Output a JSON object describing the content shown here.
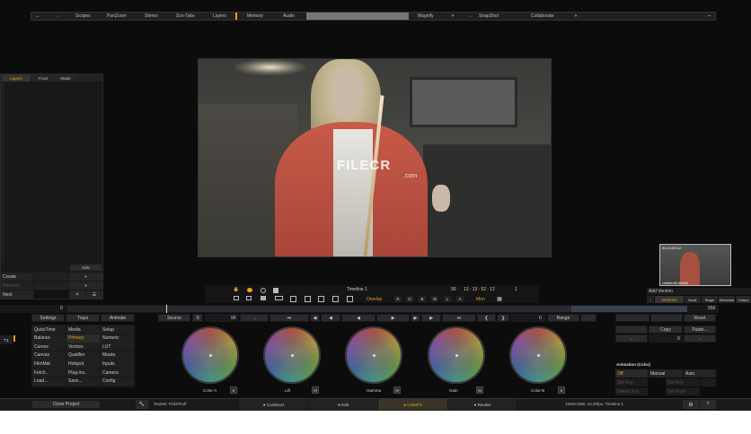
{
  "topbar": {
    "items": [
      "Scopes",
      "PanZoom",
      "Stereo",
      "Scn-Take",
      "Layers",
      "Memory",
      "Audio"
    ],
    "magnify": "Magnify",
    "snapshot": "SnapShot",
    "collaborate": "Collaborate",
    "minimize": "–"
  },
  "left_panel": {
    "tabs": [
      "Layers",
      "Front",
      "Matte"
    ],
    "solo": "Solo",
    "create": "Create",
    "remove": "Remove",
    "next": "Next",
    "plus": "+",
    "close": "×"
  },
  "viewer": {
    "watermark": "FILECR",
    "watermark_sub": ".com"
  },
  "thumbnail": {
    "timecode": "01:13:52:12",
    "name": "Untitled0140000"
  },
  "timeline_bar": {
    "title": "Timeline 1",
    "frame": "90",
    "timecode": "13 : 13 : 52 : 12",
    "count": "1",
    "overlay": "Overlay",
    "channels": [
      "R",
      "G",
      "B",
      "M",
      "L",
      "A"
    ],
    "mon": "Mon"
  },
  "scrub": {
    "start": "0",
    "end": "550"
  },
  "right_side": {
    "add_version": "Add Version",
    "tabs": [
      "Versions",
      "Node",
      "Stage",
      "Metadata",
      "Output"
    ]
  },
  "controls": {
    "settings": "Settings",
    "trays": "Trays",
    "animate": "Animate",
    "source": "Source",
    "s": "S",
    "frame_value": "90",
    "range": "Range",
    "range_value": "0",
    "reset": "Reset",
    "copy": "Copy",
    "paste": "Paste...",
    "copy_value": "0"
  },
  "tool_grid": {
    "col1": [
      "QuickTime",
      "Balance",
      "Curves",
      "Canvas",
      "FilmMat",
      "Fetch..",
      "Load..."
    ],
    "col2": [
      "Media",
      "Primary",
      "Vectors",
      "Qualifier",
      "Hotspot",
      "Plug-ins..",
      "Save..."
    ],
    "col3": [
      "Setup",
      "Numeric",
      "LUT",
      "Masks",
      "Inputs",
      "Camera",
      "Config"
    ]
  },
  "wheels": [
    {
      "label": "Color-A",
      "btn": "S"
    },
    {
      "label": "Lift",
      "btn": "M"
    },
    {
      "label": "Gamma",
      "btn": "M"
    },
    {
      "label": "Gain",
      "btn": "M"
    },
    {
      "label": "Color-B",
      "btn": "S"
    }
  ],
  "animation": {
    "title": "Animation (Color)",
    "modes": [
      "Off",
      "Manual",
      "Auto"
    ],
    "row2": [
      "Set Key",
      "Del Key"
    ],
    "row3": [
      "Delete Key",
      "Del Keys"
    ]
  },
  "t1": "T1",
  "bottom": {
    "close_project": "Close Project",
    "textset": "Textset: FinishFull",
    "tabs": [
      "Construct",
      "Edit",
      "ColorFX",
      "Render"
    ],
    "status": "1920x1080, 24.00fps, Timeline 1",
    "help": "?"
  },
  "colors": {
    "accent": "#f0a020",
    "background": "#0c0c0c",
    "panel": "#1e1e1e"
  }
}
